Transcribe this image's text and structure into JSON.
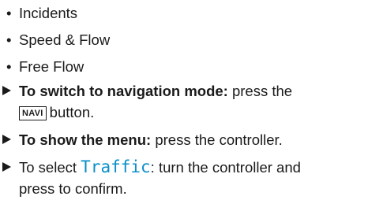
{
  "bullets": [
    {
      "marker": "•",
      "text": "Incidents"
    },
    {
      "marker": "•",
      "text": "Speed & Flow"
    },
    {
      "marker": "•",
      "text": "Free Flow"
    }
  ],
  "steps": {
    "step1": {
      "bold": "To switch to navigation mode:",
      "text_a": " press the",
      "key": "NAVI",
      "text_b": "button."
    },
    "step2": {
      "bold": "To show the menu:",
      "text": " press the controller."
    },
    "step3": {
      "text_a": "To select ",
      "display": "Traffic",
      "text_b": ": turn the controller and",
      "text_c": "press to confirm."
    }
  },
  "colors": {
    "text": "#1a1a1a",
    "display_text": "#0a8fc9"
  },
  "icons": {
    "step_marker": "triangle-right-icon"
  }
}
